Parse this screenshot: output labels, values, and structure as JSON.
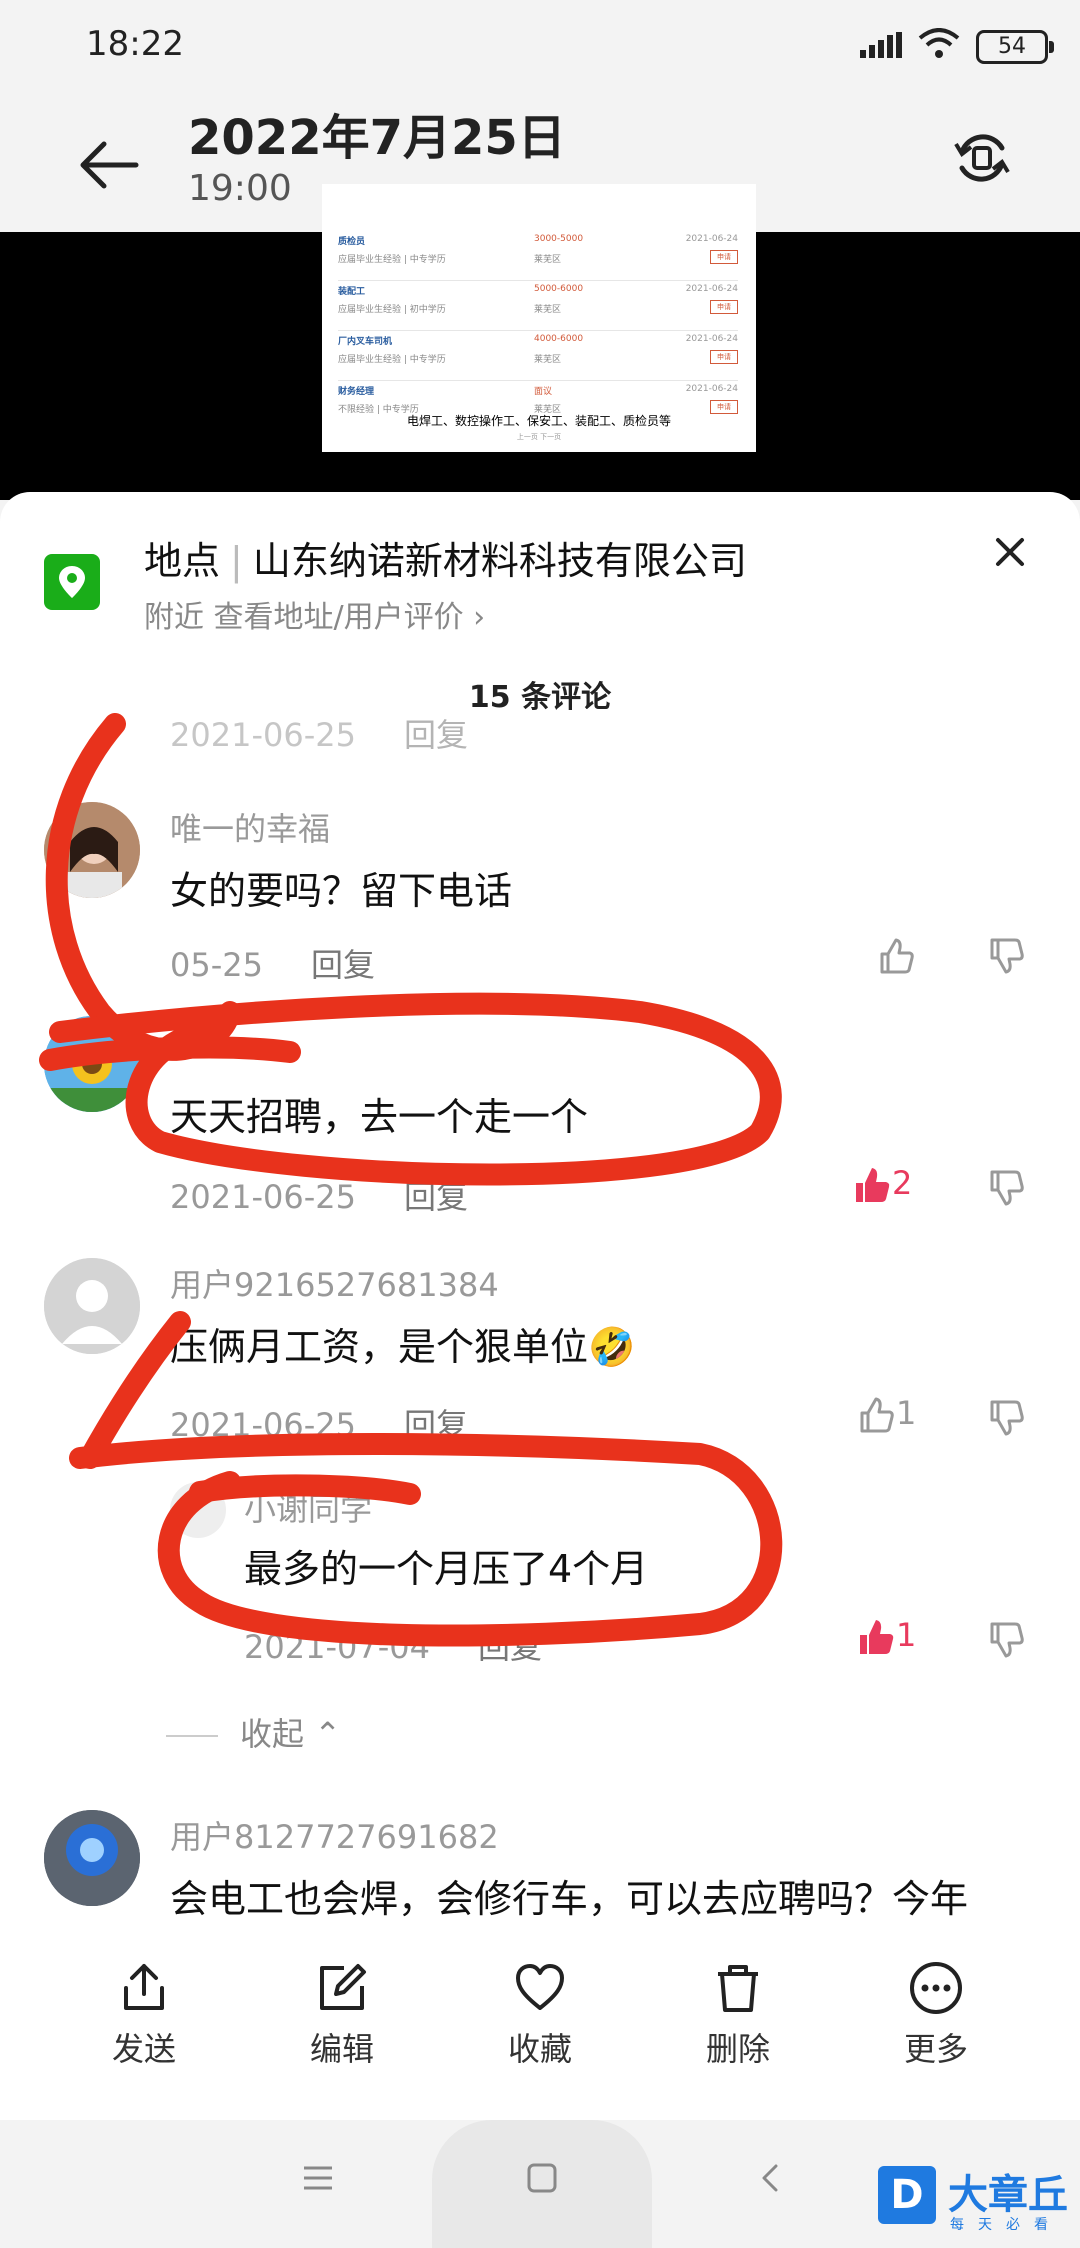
{
  "status": {
    "time": "18:22",
    "battery": "54"
  },
  "header": {
    "title": "2022年7月25日",
    "subtitle": "19:00"
  },
  "thumbnail": {
    "jobs": [
      {
        "title": "质检员",
        "sub": "应届毕业生经验 | 中专学历",
        "pay": "3000-5000",
        "area": "莱芜区",
        "date": "2021-06-24",
        "btn": "申请"
      },
      {
        "title": "装配工",
        "sub": "应届毕业生经验 | 初中学历",
        "pay": "5000-6000",
        "area": "莱芜区",
        "date": "2021-06-24",
        "btn": "申请"
      },
      {
        "title": "厂内叉车司机",
        "sub": "应届毕业生经验 | 中专学历",
        "pay": "4000-6000",
        "area": "莱芜区",
        "date": "2021-06-24",
        "btn": "申请"
      },
      {
        "title": "财务经理",
        "sub": "不限经验 | 中专学历",
        "pay": "面议",
        "area": "莱芜区",
        "date": "2021-06-24",
        "btn": "申请"
      }
    ],
    "caption": "电焊工、数控操作工、保安工、装配工、质检员等",
    "pager": "上一页    下一页"
  },
  "location": {
    "label": "地点",
    "name": "山东纳诺新材料科技有限公司",
    "sub": "附近  查看地址/用户评价 ›"
  },
  "comment_count": "15 条评论",
  "comments": [
    {
      "user": "",
      "text": "",
      "date": "2021-06-25",
      "reply": "回复",
      "likes": ""
    },
    {
      "user": "唯一的幸福",
      "text": "女的要吗？留下电话",
      "date": "05-25",
      "reply": "回复",
      "likes": ""
    },
    {
      "user": "",
      "text": "天天招聘，去一个走一个",
      "date": "2021-06-25",
      "reply": "回复",
      "likes": "2"
    },
    {
      "user": "用户9216527681384",
      "text": "压俩月工资，是个狠单位🤣",
      "date": "2021-06-25",
      "reply": "回复",
      "likes": "1"
    },
    {
      "user": "小谢同学",
      "text": "最多的一个月压了4个月",
      "date": "2021-07-04",
      "reply": "回复",
      "likes": "1"
    },
    {
      "user": "用户8127727691682",
      "text": "会电工也会焊，会修行车，可以去应聘吗？今年",
      "date": "",
      "reply": "",
      "likes": ""
    }
  ],
  "fold_label": "收起",
  "toolbar": [
    {
      "label": "发送",
      "icon": "share-icon"
    },
    {
      "label": "编辑",
      "icon": "edit-icon"
    },
    {
      "label": "收藏",
      "icon": "heart-icon"
    },
    {
      "label": "删除",
      "icon": "trash-icon"
    },
    {
      "label": "更多",
      "icon": "more-icon"
    }
  ],
  "watermark": {
    "text": "大章丘",
    "sub": "每天必看"
  },
  "colors": {
    "accent_red": "#e83a5d",
    "location_green": "#1aad19",
    "scribble": "#e8321c"
  }
}
